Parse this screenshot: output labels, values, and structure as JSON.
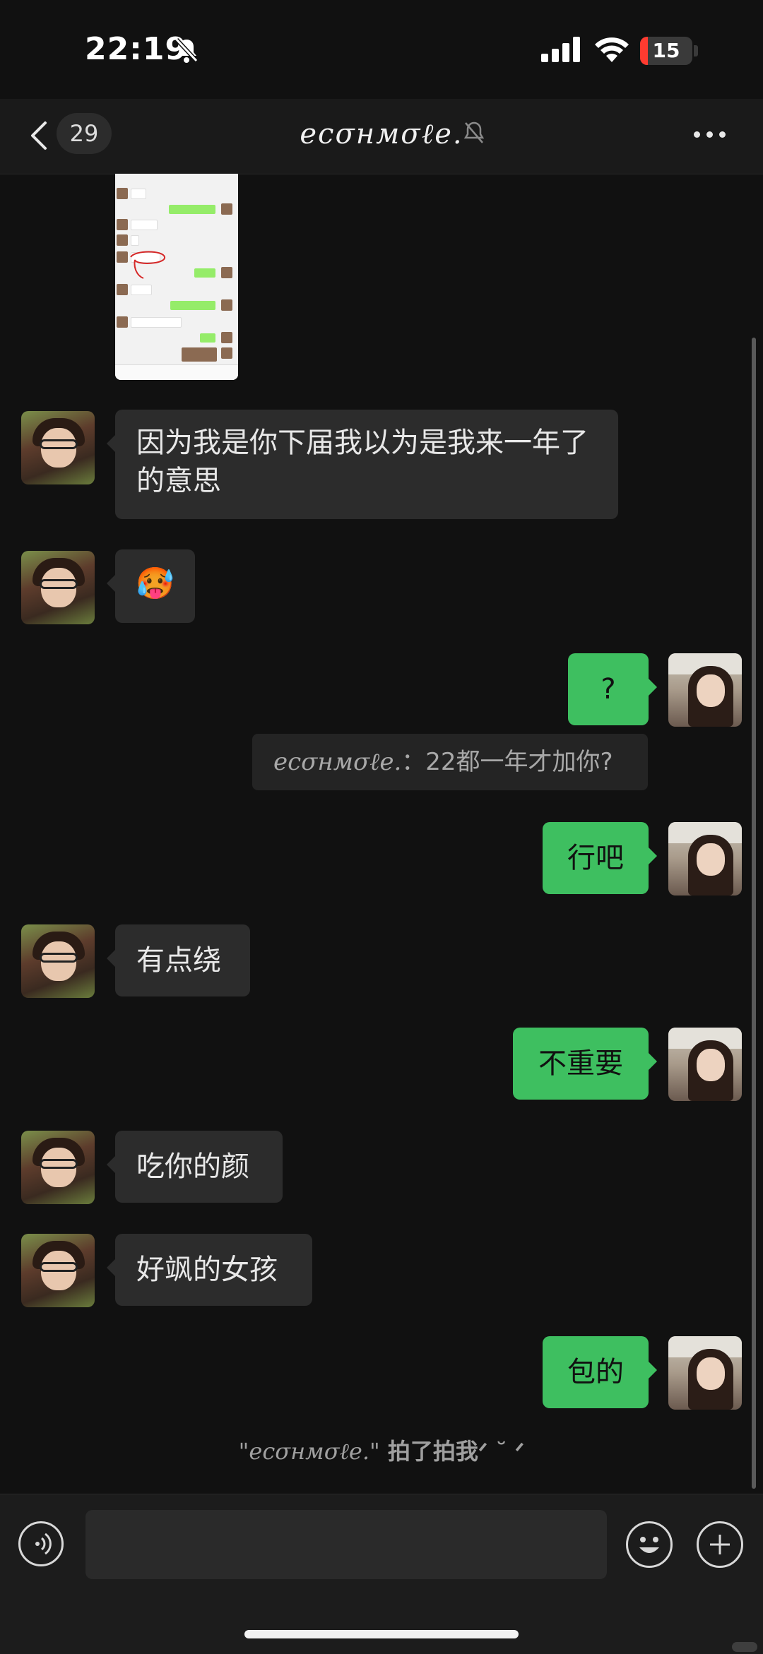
{
  "status_bar": {
    "time": "22:19",
    "battery": "15",
    "battery_level": 0.15,
    "icons": [
      "bell-slash-icon",
      "cellular-signal-icon",
      "wifi-icon",
      "battery-icon"
    ]
  },
  "header": {
    "unread_count": "29",
    "title": "ecσнмσℓe.",
    "icons": [
      "back-chevron-icon",
      "muted-bell-icon",
      "more-icon"
    ]
  },
  "messages": [
    {
      "side": "left",
      "text": "因为我是你下届我以为是我来一年了的意思"
    },
    {
      "side": "left",
      "text": "🥵",
      "kind": "emoji"
    },
    {
      "side": "right",
      "text": "?"
    },
    {
      "kind": "quote",
      "name": "ecσнмσℓe.",
      "sep": "：",
      "text": "22都一年才加你?"
    },
    {
      "side": "right",
      "text": "行吧"
    },
    {
      "side": "left",
      "text": "有点绕"
    },
    {
      "side": "right",
      "text": "不重要"
    },
    {
      "side": "left",
      "text": "吃你的颜"
    },
    {
      "side": "left",
      "text": "好飒的女孩"
    },
    {
      "side": "right",
      "text": "包的"
    }
  ],
  "system_note": {
    "name": "\"ecσнмσℓe.\"",
    "text": " 拍了拍我ᐟ ˘ ᐟ"
  },
  "input_bar": {
    "value": "",
    "placeholder": "",
    "icons": [
      "voice-icon",
      "emoji-face-icon",
      "plus-icon"
    ]
  },
  "colors": {
    "background": "#111111",
    "incoming_bubble": "#2c2c2c",
    "outgoing_bubble": "#3ebf60",
    "battery_red": "#ff3b30"
  }
}
